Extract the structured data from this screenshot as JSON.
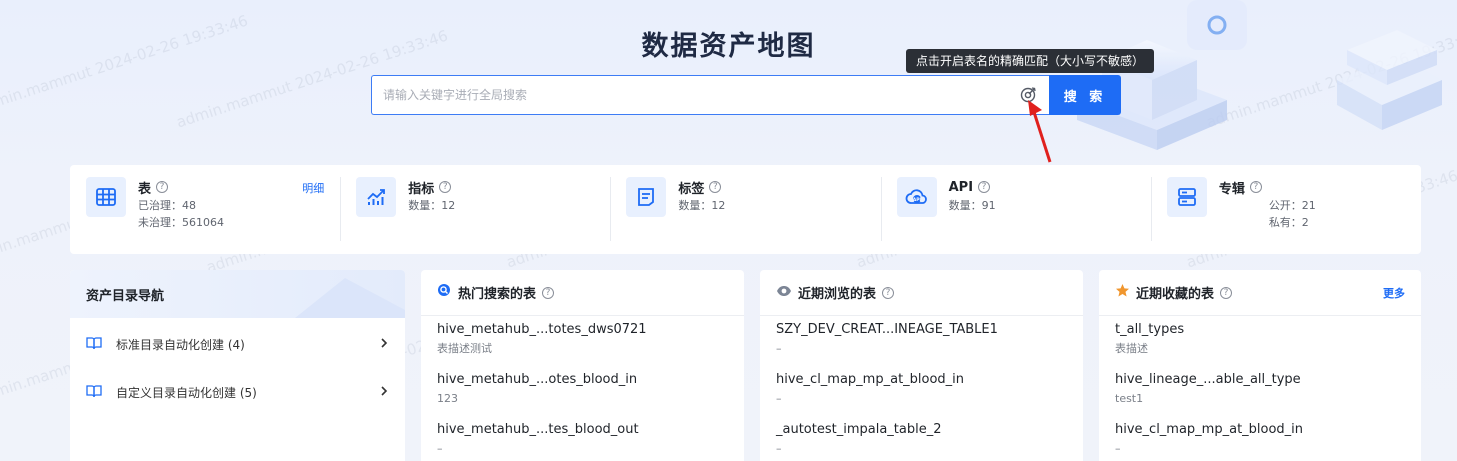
{
  "page": {
    "title": "数据资产地图"
  },
  "search": {
    "placeholder": "请输入关键字进行全局搜索",
    "button_label": "搜 索",
    "tooltip": "点击开启表名的精确匹配（大小写不敏感）"
  },
  "watermark": "admin.mammut 2024-02-26 19:33:46",
  "stats": [
    {
      "key": "table",
      "title": "表",
      "lines": [
        "已治理：48",
        "未治理：561064"
      ],
      "detail": "明细",
      "icon": "table-icon"
    },
    {
      "key": "metric",
      "title": "指标",
      "lines": [
        "数量：12"
      ],
      "icon": "chart-icon"
    },
    {
      "key": "tag",
      "title": "标签",
      "lines": [
        "数量：12"
      ],
      "icon": "tag-doc-icon"
    },
    {
      "key": "api",
      "title": "API",
      "lines": [
        "数量：91"
      ],
      "icon": "api-cloud-icon"
    },
    {
      "key": "album",
      "title": "专辑",
      "lines": [
        "公开：21",
        "私有：2"
      ],
      "icon": "server-icon"
    }
  ],
  "nav": {
    "title": "资产目录导航",
    "items": [
      {
        "label": "标准目录自动化创建 (4)"
      },
      {
        "label": "自定义目录自动化创建 (5)"
      }
    ]
  },
  "hot": {
    "title": "热门搜索的表",
    "rows": [
      {
        "name": "hive_metahub_...totes_dws0721",
        "desc": "表描述测试"
      },
      {
        "name": "hive_metahub_...otes_blood_in",
        "desc": "123"
      },
      {
        "name": "hive_metahub_...tes_blood_out",
        "desc": "–"
      }
    ]
  },
  "recent": {
    "title": "近期浏览的表",
    "rows": [
      {
        "name": "SZY_DEV_CREAT...INEAGE_TABLE1",
        "desc": "–"
      },
      {
        "name": "hive_cl_map_mp_at_blood_in",
        "desc": "–"
      },
      {
        "name": "_autotest_impala_table_2",
        "desc": "–"
      }
    ]
  },
  "fav": {
    "title": "近期收藏的表",
    "more": "更多",
    "rows": [
      {
        "name": "t_all_types",
        "desc": "表描述"
      },
      {
        "name": "hive_lineage_...able_all_type",
        "desc": "test1"
      },
      {
        "name": "hive_cl_map_mp_at_blood_in",
        "desc": "–"
      }
    ]
  },
  "colors": {
    "primary": "#1e6cf5",
    "accent_star": "#f0962e",
    "text": "#1f2329"
  }
}
